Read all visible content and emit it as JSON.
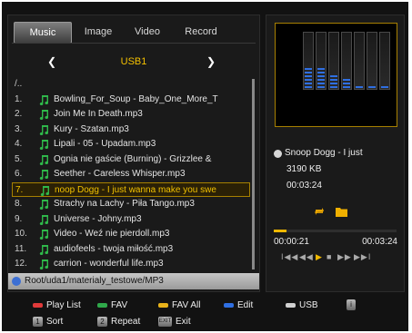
{
  "tabs": [
    {
      "label": "Music",
      "active": true
    },
    {
      "label": "Image",
      "active": false
    },
    {
      "label": "Video",
      "active": false
    },
    {
      "label": "Record",
      "active": false
    }
  ],
  "source": {
    "prev": "❮",
    "label": "USB1",
    "next": "❯"
  },
  "files": [
    {
      "num": "/..",
      "name": "",
      "music": false
    },
    {
      "num": "1.",
      "name": "Bowling_For_Soup - Baby_One_More_T",
      "music": true
    },
    {
      "num": "2.",
      "name": "Join Me In Death.mp3",
      "music": true
    },
    {
      "num": "3.",
      "name": "Kury - Szatan.mp3",
      "music": true
    },
    {
      "num": "4.",
      "name": "Lipali - 05 - Upadam.mp3",
      "music": true
    },
    {
      "num": "5.",
      "name": "Ognia nie gaście (Burning) - Grizzlee &",
      "music": true
    },
    {
      "num": "6.",
      "name": "Seether - Careless Whisper.mp3",
      "music": true
    },
    {
      "num": "7.",
      "name": "noop Dogg - I just wanna make you swe",
      "music": true,
      "selected": true
    },
    {
      "num": "8.",
      "name": "Strachy na Lachy - Piła Tango.mp3",
      "music": true
    },
    {
      "num": "9.",
      "name": "Universe - Johny.mp3",
      "music": true
    },
    {
      "num": "10.",
      "name": "Video - Weź nie pierdoll.mp3",
      "music": true
    },
    {
      "num": "11.",
      "name": "audiofeels - twoja miłość.mp3",
      "music": true
    },
    {
      "num": "12.",
      "name": "carrion - wonderful life.mp3",
      "music": true
    }
  ],
  "path": "Root/uda1/materialy_testowe/MP3",
  "now_playing": {
    "title": "Snoop Dogg - I just",
    "size": "3190 KB",
    "duration": "00:03:24",
    "elapsed": "00:00:21",
    "total": "00:03:24",
    "progress": 0.1
  },
  "equalizer_levels": [
    0.3,
    0.3,
    0.2,
    0.15,
    0.05,
    0.05,
    0.05
  ],
  "transport": {
    "prev": "I◀◀",
    "rewind": "◀◀",
    "play": "▶",
    "stop": "■",
    "forward": "▶▶",
    "next": "▶▶I"
  },
  "legend": {
    "red": {
      "label": "Play List",
      "color": "#e03a3a"
    },
    "green": {
      "label": "FAV",
      "color": "#2fa84a"
    },
    "yellow": {
      "label": "FAV All",
      "color": "#e8b21a"
    },
    "blue": {
      "label": "Edit",
      "color": "#2f6fe2"
    },
    "white": {
      "label": "USB",
      "color": "#d0d0d0"
    },
    "info": "i",
    "key1": {
      "key": "1",
      "label": "Sort"
    },
    "key2": {
      "key": "2",
      "label": "Repeat"
    },
    "exit": {
      "key": "EXIT",
      "label": "Exit"
    }
  },
  "colors": {
    "accent": "#f0c000",
    "equalizer_bar": "#2f6fe2"
  }
}
